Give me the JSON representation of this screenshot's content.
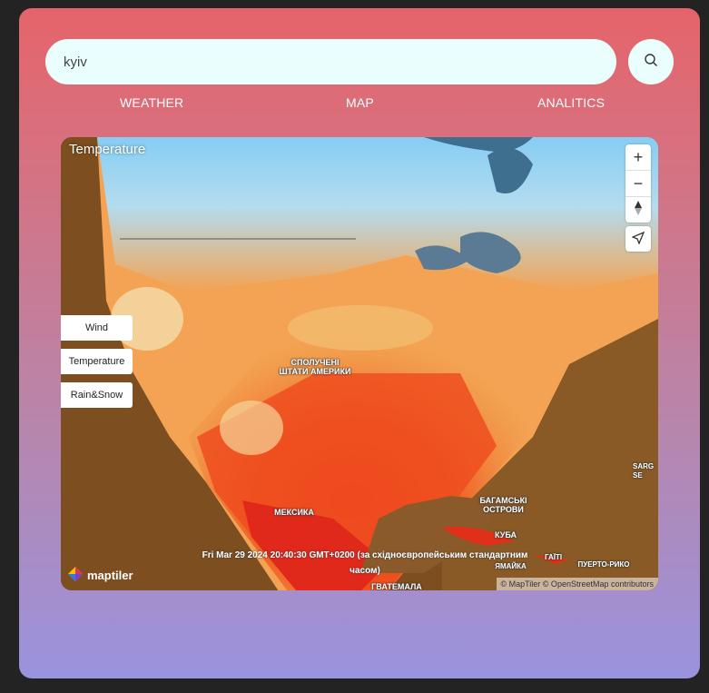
{
  "search": {
    "value": "kyiv"
  },
  "tabs": [
    "WEATHER",
    "MAP",
    "ANALITICS"
  ],
  "map": {
    "layer_title": "Temperature",
    "zoom_in": "+",
    "zoom_out": "−",
    "layer_buttons": [
      "Wind",
      "Temperature",
      "Rain&Snow"
    ],
    "labels": {
      "usa": "СПОЛУЧЕНІ\nШТАТИ АМЕРИКИ",
      "mexico": "МЕКСИКА",
      "bahamas": "БАГАМСЬКІ\nОСТРОВИ",
      "cuba": "КУБА",
      "jamaica": "ЯМАЙКА",
      "haiti": "ГАЇТІ",
      "puerto_rico": "ПУЕРТО-РИКО",
      "guatemala": "ГВАТЕМАЛА",
      "sargasso": "SARG\nSE"
    },
    "timestamp": "Fri Mar 29 2024 20:40:30 GMT+0200 (за східноєвропейським стандартним часом)",
    "logo_text": "maptiler",
    "attribution": "© MapTiler © OpenStreetMap contributors"
  },
  "colors": {
    "accent_top": "#e5646a",
    "accent_bottom": "#9a93de",
    "field_bg": "#eafffd"
  }
}
